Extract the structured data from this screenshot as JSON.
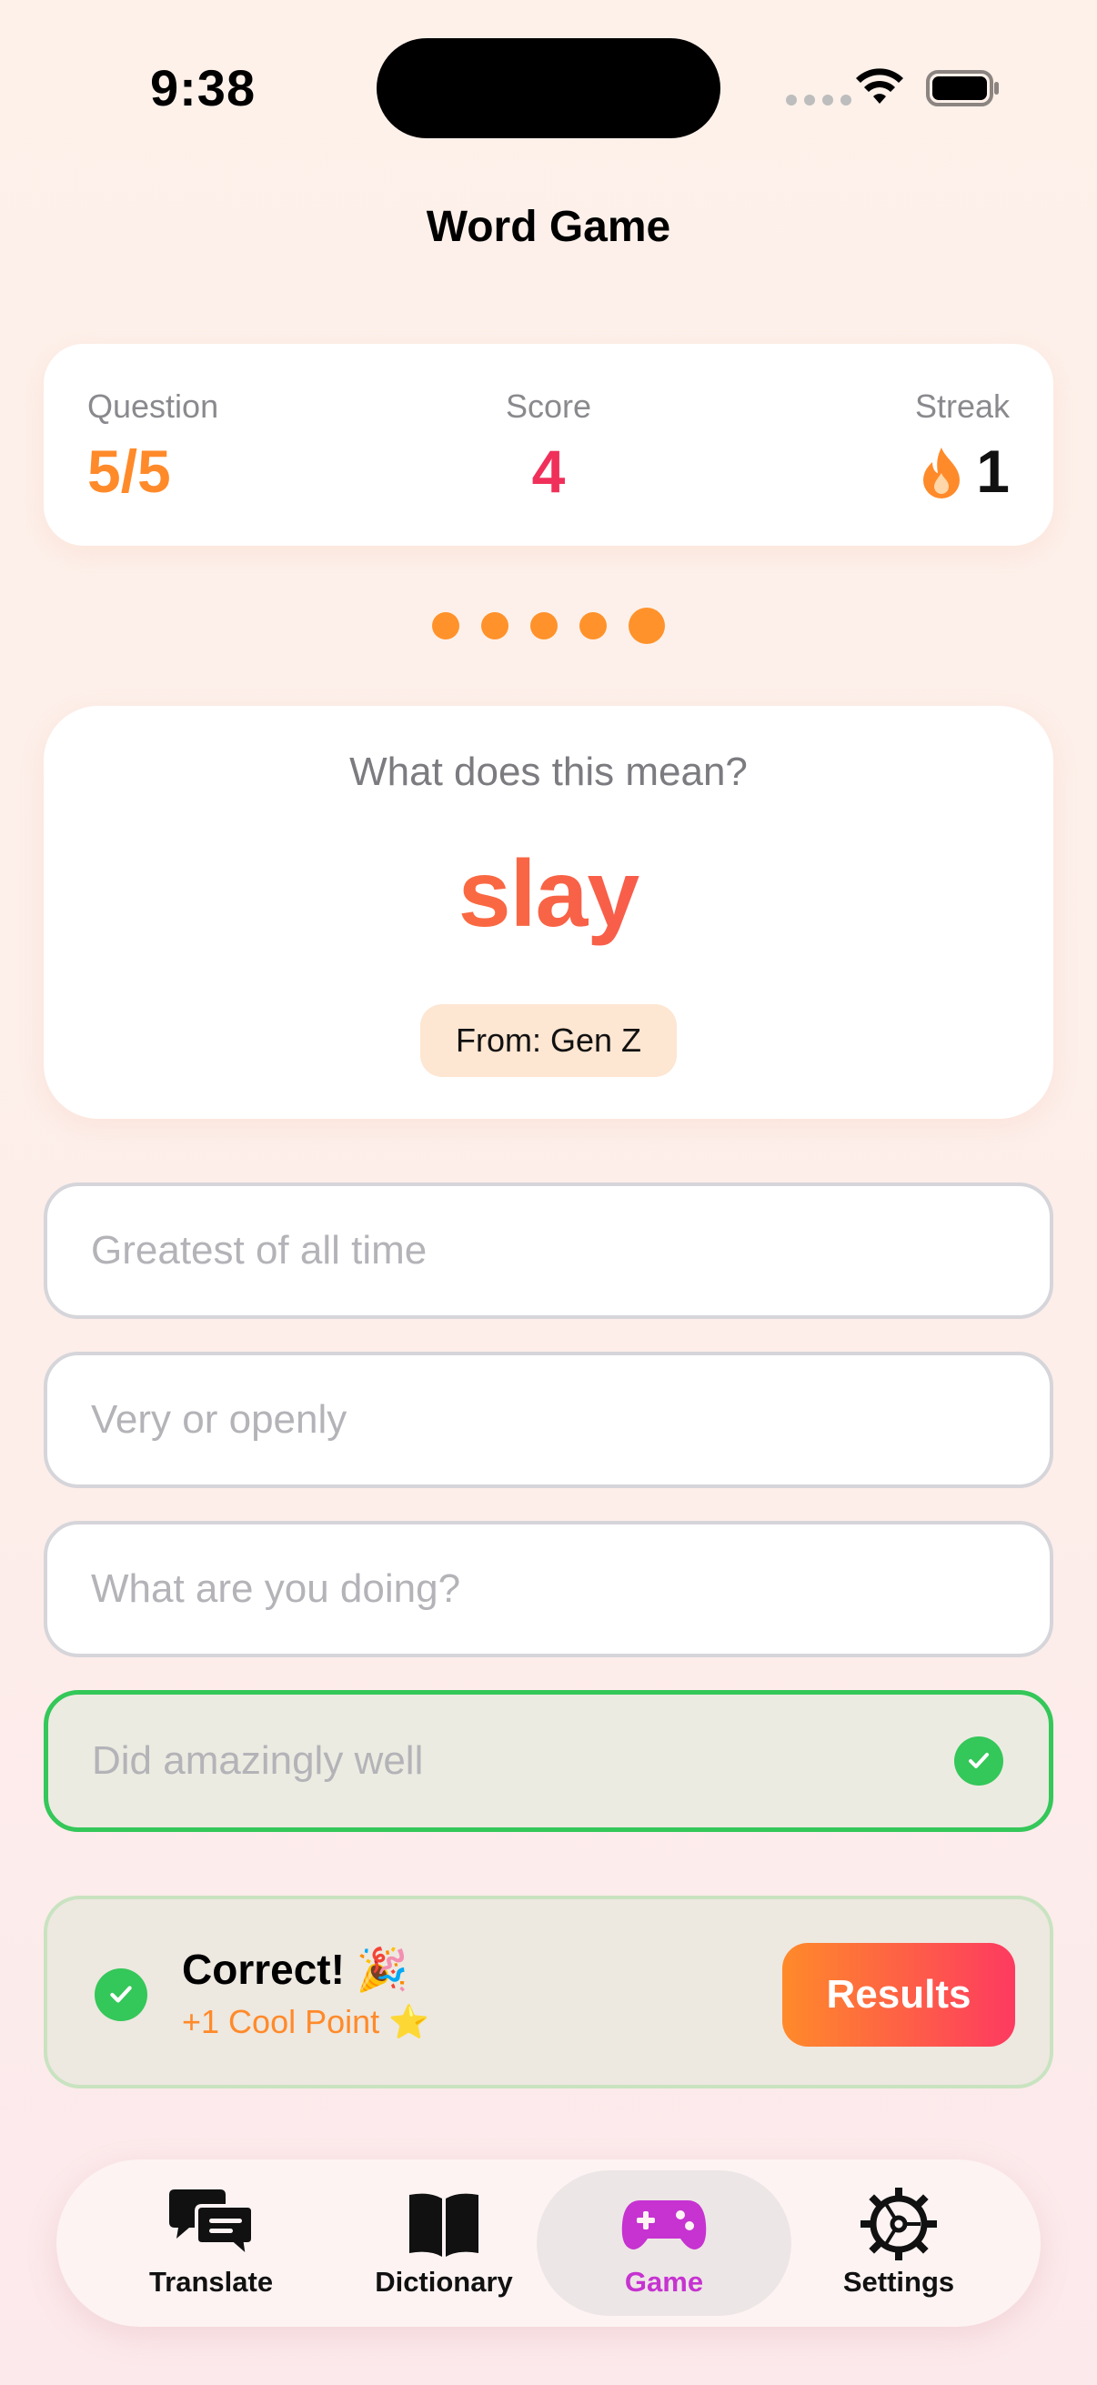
{
  "status_bar": {
    "time": "9:38"
  },
  "header": {
    "title": "Word Game"
  },
  "stats": {
    "question_label": "Question",
    "question_value": "5/5",
    "score_label": "Score",
    "score_value": "4",
    "streak_label": "Streak",
    "streak_value": "1"
  },
  "progress": {
    "total": 5,
    "current": 5
  },
  "question": {
    "prompt": "What does this mean?",
    "word": "slay",
    "origin": "From: Gen Z"
  },
  "options": [
    {
      "text": "Greatest of all time",
      "state": "default"
    },
    {
      "text": "Very or openly",
      "state": "default"
    },
    {
      "text": "What are you doing?",
      "state": "default"
    },
    {
      "text": "Did amazingly well",
      "state": "correct"
    }
  ],
  "feedback": {
    "title": "Correct! 🎉",
    "subtitle": "+1 Cool Point ⭐",
    "results_label": "Results"
  },
  "tabs": [
    {
      "label": "Translate",
      "icon": "chat-bubbles-icon",
      "active": false
    },
    {
      "label": "Dictionary",
      "icon": "book-icon",
      "active": false
    },
    {
      "label": "Game",
      "icon": "gamepad-icon",
      "active": true
    },
    {
      "label": "Settings",
      "icon": "gear-icon",
      "active": false
    }
  ],
  "colors": {
    "accent_orange": "#ff8a2a",
    "accent_red": "#f0305a",
    "success_green": "#34c759",
    "active_tab": "#c633d1"
  }
}
